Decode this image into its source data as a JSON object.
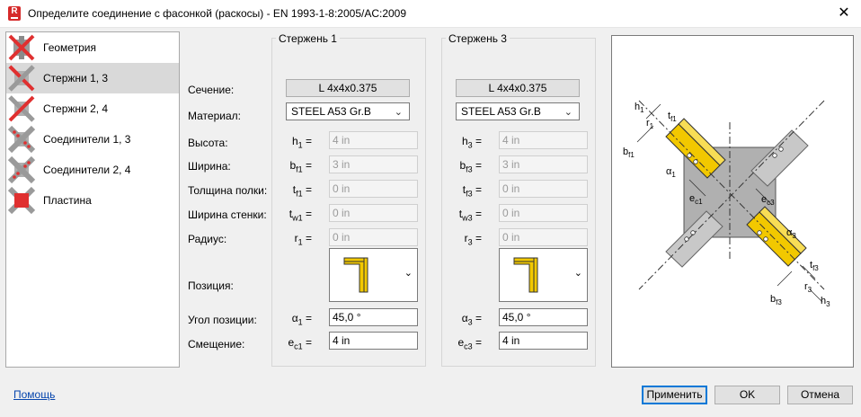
{
  "window": {
    "title": "Определите соединение с фасонкой (раскосы)  - EN 1993-1-8:2005/AC:2009",
    "close_glyph": "✕",
    "app_icon_letter": "R"
  },
  "sidebar": {
    "items": [
      {
        "label": "Геометрия",
        "icon": "x-geometry-icon"
      },
      {
        "label": "Стержни 1, 3",
        "icon": "x-bars-icon",
        "active": true
      },
      {
        "label": "Стержни 2, 4",
        "icon": "x-bars-icon"
      },
      {
        "label": "Соединители 1, 3",
        "icon": "x-connectors-icon"
      },
      {
        "label": "Соединители 2, 4",
        "icon": "x-connectors-icon"
      },
      {
        "label": "Пластина",
        "icon": "x-plate-icon"
      }
    ]
  },
  "labels": {
    "section": "Сечение:",
    "material": "Материал:",
    "height": "Высота:",
    "width": "Ширина:",
    "flange_thickness": "Толщина полки:",
    "web_width": "Ширина стенки:",
    "radius": "Радиус:",
    "position": "Позиция:",
    "position_angle": "Угол позиции:",
    "offset": "Смещение:"
  },
  "bar1": {
    "title": "Стержень 1",
    "section": "L 4x4x0.375",
    "material": "STEEL A53 Gr.B",
    "height": {
      "sym": "h",
      "sub": "1",
      "value": "4 in"
    },
    "width": {
      "sym": "b",
      "sub": "f1",
      "value": "3 in"
    },
    "flange": {
      "sym": "t",
      "sub": "f1",
      "value": "0 in"
    },
    "web": {
      "sym": "t",
      "sub": "w1",
      "value": "0 in"
    },
    "radius": {
      "sym": "r",
      "sub": "1",
      "value": "0 in"
    },
    "angle": {
      "sym": "α",
      "sub": "1",
      "value": "45,0 °"
    },
    "offset": {
      "sym": "e",
      "sub": "c1",
      "value": "4 in"
    }
  },
  "bar3": {
    "title": "Стержень 3",
    "section": "L 4x4x0.375",
    "material": "STEEL A53 Gr.B",
    "height": {
      "sym": "h",
      "sub": "3",
      "value": "4 in"
    },
    "width": {
      "sym": "b",
      "sub": "f3",
      "value": "3 in"
    },
    "flange": {
      "sym": "t",
      "sub": "f3",
      "value": "0 in"
    },
    "web": {
      "sym": "t",
      "sub": "w3",
      "value": "0 in"
    },
    "radius": {
      "sym": "r",
      "sub": "3",
      "value": "0 in"
    },
    "angle": {
      "sym": "α",
      "sub": "3",
      "value": "45,0 °"
    },
    "offset": {
      "sym": "e",
      "sub": "c3",
      "value": "4 in"
    }
  },
  "eq": "=",
  "drawing_labels": {
    "h1": "h",
    "h1s": "1",
    "r1": "r",
    "r1s": "1",
    "tf1": "t",
    "tf1s": "f1",
    "bf1": "b",
    "bf1s": "f1",
    "a1": "α",
    "a1s": "1",
    "ec1": "e",
    "ec1s": "c1",
    "ec3": "e",
    "ec3s": "c3",
    "a3": "α",
    "a3s": "3",
    "tf3": "t",
    "tf3s": "f3",
    "r3": "r",
    "r3s": "3",
    "bf3": "b",
    "bf3s": "f3",
    "h3": "h",
    "h3s": "3"
  },
  "footer": {
    "help": "Помощь",
    "apply": "Применить",
    "ok": "OK",
    "cancel": "Отмена"
  },
  "colors": {
    "accent": "#0078d7",
    "steel_yellow": "#f2c800",
    "red_x": "#e03030",
    "plate_gray": "#a8a8a8"
  }
}
